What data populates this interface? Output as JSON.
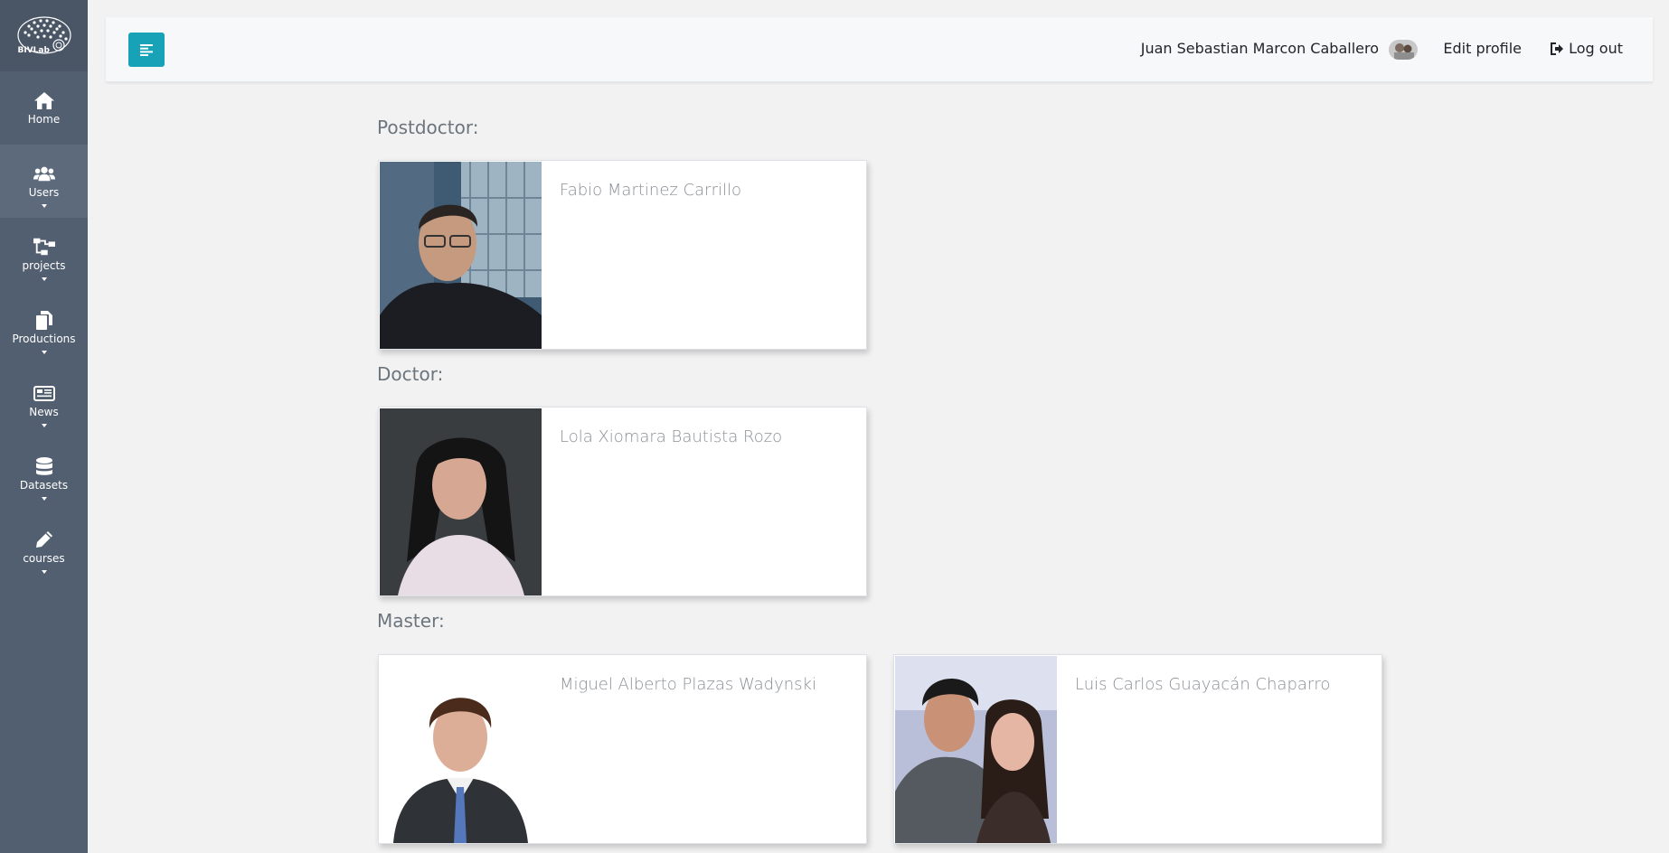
{
  "sidebar": {
    "logo_text": "BIVLab",
    "items": [
      {
        "label": "Home",
        "icon": "home-icon",
        "has_caret": false
      },
      {
        "label": "Users",
        "icon": "users-icon",
        "has_caret": true
      },
      {
        "label": "projects",
        "icon": "sitemap-icon",
        "has_caret": true
      },
      {
        "label": "Productions",
        "icon": "copy-icon",
        "has_caret": true
      },
      {
        "label": "News",
        "icon": "newspaper-icon",
        "has_caret": true
      },
      {
        "label": "Datasets",
        "icon": "database-icon",
        "has_caret": true
      },
      {
        "label": "courses",
        "icon": "pencil-icon",
        "has_caret": true
      }
    ]
  },
  "header": {
    "user_name": "Juan Sebastian Marcon Caballero",
    "edit_profile_label": "Edit profile",
    "logout_label": "Log out",
    "accent_color": "#17a2b8"
  },
  "sections": [
    {
      "title": "Postdoctor:",
      "members": [
        {
          "name": "Fabio Martinez Carrillo"
        }
      ]
    },
    {
      "title": "Doctor:",
      "members": [
        {
          "name": "Lola Xiomara Bautista Rozo"
        }
      ]
    },
    {
      "title": "Master:",
      "members": [
        {
          "name": "Miguel Alberto Plazas Wadynski"
        },
        {
          "name": "Luis Carlos Guayacán Chaparro"
        }
      ]
    }
  ]
}
